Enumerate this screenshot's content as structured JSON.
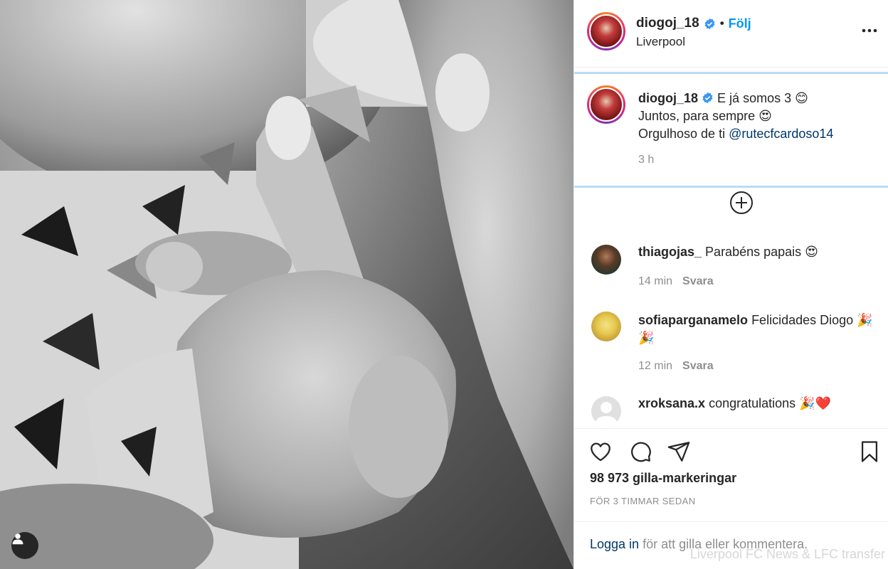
{
  "post": {
    "photo_alt": "",
    "author": "diogoj_18",
    "location": "Liverpool",
    "follow_label": "Följ",
    "separator": "•",
    "more_label": "•••"
  },
  "caption": {
    "username": "diogoj_18",
    "line1": "E já somos 3 😊",
    "line2": "Juntos, para sempre 😍",
    "line3_prefix": "Orgulhoso de ti ",
    "mention": "@rutecfcardoso14",
    "time": "3 h"
  },
  "comments": [
    {
      "username": "thiagojas_",
      "text": "Parabéns papais 😍",
      "time": "14 min",
      "reply": "Svara"
    },
    {
      "username": "sofiaparganamelo",
      "text": "Felicidades Diogo 🎉🎉",
      "time": "12 min",
      "reply": "Svara"
    },
    {
      "username": "xroksana.x",
      "text": "congratulations 🎉❤️"
    }
  ],
  "stats": {
    "likes": "98 973 gilla-markeringar",
    "posted": "FÖR 3 TIMMAR SEDAN"
  },
  "footer": {
    "login": "Logga in",
    "login_rest": " för att gilla eller kommentera."
  },
  "watermark": "Liverpool FC News & LFC transfer",
  "colors": {
    "link_blue": "#0095f6",
    "mention_blue": "#00376b",
    "muted": "#8e8e8e",
    "text": "#262626"
  },
  "icons": [
    "heart-icon",
    "comment-icon",
    "share-icon",
    "bookmark-icon",
    "plus-circle-icon",
    "verified-badge-icon",
    "user-tag-icon"
  ]
}
